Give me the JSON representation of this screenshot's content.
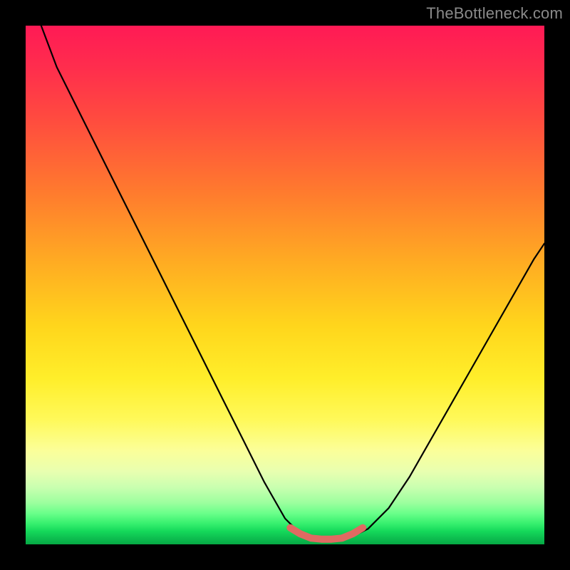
{
  "watermark": {
    "text": "TheBottleneck.com"
  },
  "colors": {
    "curve": "#000000",
    "marker": "#e06a62",
    "background_black": "#000000"
  },
  "chart_data": {
    "type": "line",
    "title": "",
    "xlabel": "",
    "ylabel": "",
    "xlim": [
      0,
      100
    ],
    "ylim": [
      0,
      100
    ],
    "series": [
      {
        "name": "bottleneck-curve",
        "x": [
          3,
          6,
          10,
          14,
          18,
          22,
          26,
          30,
          34,
          38,
          42,
          46,
          50,
          52,
          54,
          56,
          58,
          60,
          62,
          64,
          66,
          70,
          74,
          78,
          82,
          86,
          90,
          94,
          98,
          100
        ],
        "y": [
          100,
          92,
          84,
          76,
          68,
          60,
          52,
          44,
          36,
          28,
          20,
          12,
          5,
          3,
          2,
          1.2,
          1,
          1,
          1.2,
          2,
          3,
          7,
          13,
          20,
          27,
          34,
          41,
          48,
          55,
          58
        ]
      }
    ],
    "annotations": [
      {
        "name": "flat-bottom-marker",
        "style": "thick-rounded",
        "color": "#e06a62",
        "x": [
          51,
          53,
          55,
          57,
          59,
          61,
          63,
          65
        ],
        "y": [
          3.2,
          2.0,
          1.2,
          1.0,
          1.0,
          1.2,
          2.0,
          3.2
        ]
      }
    ]
  }
}
